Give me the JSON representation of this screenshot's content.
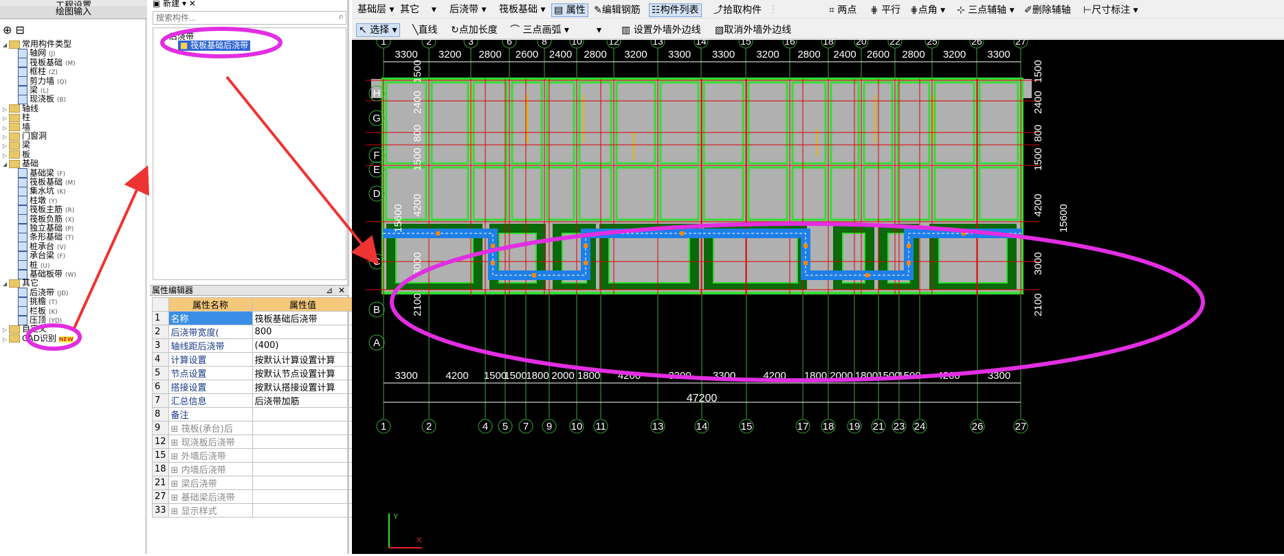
{
  "left_panel": {
    "header1": "工程设置",
    "header2": "绘图输入",
    "tree": [
      {
        "label": "常用构件类型",
        "type": "folder",
        "level": 0,
        "open": true
      },
      {
        "label": "轴网",
        "hint": "(J)",
        "type": "item",
        "level": 1
      },
      {
        "label": "筏板基础",
        "hint": "(M)",
        "type": "item",
        "level": 1
      },
      {
        "label": "框柱",
        "hint": "(Z)",
        "type": "item",
        "level": 1
      },
      {
        "label": "剪力墙",
        "hint": "(Q)",
        "type": "item",
        "level": 1
      },
      {
        "label": "梁",
        "hint": "(L)",
        "type": "item",
        "level": 1
      },
      {
        "label": "现浇板",
        "hint": "(B)",
        "type": "item",
        "level": 1
      },
      {
        "label": "轴线",
        "type": "folder",
        "level": 0
      },
      {
        "label": "柱",
        "type": "folder",
        "level": 0
      },
      {
        "label": "墙",
        "type": "folder",
        "level": 0
      },
      {
        "label": "门窗洞",
        "type": "folder",
        "level": 0
      },
      {
        "label": "梁",
        "type": "folder",
        "level": 0
      },
      {
        "label": "板",
        "type": "folder",
        "level": 0
      },
      {
        "label": "基础",
        "type": "folder",
        "level": 0,
        "open": true
      },
      {
        "label": "基础梁",
        "hint": "(F)",
        "type": "item",
        "level": 1
      },
      {
        "label": "筏板基础",
        "hint": "(M)",
        "type": "item",
        "level": 1
      },
      {
        "label": "集水坑",
        "hint": "(K)",
        "type": "item",
        "level": 1
      },
      {
        "label": "柱墩",
        "hint": "(Y)",
        "type": "item",
        "level": 1
      },
      {
        "label": "筏板主筋",
        "hint": "(R)",
        "type": "item",
        "level": 1
      },
      {
        "label": "筏板负筋",
        "hint": "(X)",
        "type": "item",
        "level": 1
      },
      {
        "label": "独立基础",
        "hint": "(P)",
        "type": "item",
        "level": 1
      },
      {
        "label": "条形基础",
        "hint": "(T)",
        "type": "item",
        "level": 1
      },
      {
        "label": "桩承台",
        "hint": "(V)",
        "type": "item",
        "level": 1
      },
      {
        "label": "承台梁",
        "hint": "(F)",
        "type": "item",
        "level": 1
      },
      {
        "label": "桩",
        "hint": "(U)",
        "type": "item",
        "level": 1
      },
      {
        "label": "基础板带",
        "hint": "(W)",
        "type": "item",
        "level": 1
      },
      {
        "label": "其它",
        "type": "folder",
        "level": 0,
        "open": true
      },
      {
        "label": "后浇带",
        "hint": "(JD)",
        "type": "item",
        "level": 1
      },
      {
        "label": "挑檐",
        "hint": "(T)",
        "type": "item",
        "level": 1
      },
      {
        "label": "栏板",
        "hint": "(K)",
        "type": "item",
        "level": 1
      },
      {
        "label": "压顶",
        "hint": "(YD)",
        "type": "item",
        "level": 1
      },
      {
        "label": "自定义",
        "type": "folder",
        "level": 0
      },
      {
        "label": "CAD识别",
        "type": "folder",
        "level": 0,
        "badge": "NEW"
      }
    ]
  },
  "component_panel": {
    "new_label": "新建",
    "search_placeholder": "搜索构件...",
    "tree_root": "后浇带",
    "tree_child": "筏板基础后浇带"
  },
  "property_editor": {
    "title": "属性编辑器",
    "col_name": "属性名称",
    "col_value": "属性值",
    "rows": [
      {
        "num": "1",
        "name": "名称",
        "value": "筏板基础后浇带"
      },
      {
        "num": "2",
        "name": "后浇带宽度(",
        "value": "800"
      },
      {
        "num": "3",
        "name": "轴线距后浇带",
        "value": "(400)"
      },
      {
        "num": "4",
        "name": "计算设置",
        "value": "按默认计算设置计算"
      },
      {
        "num": "5",
        "name": "节点设置",
        "value": "按默认节点设置计算"
      },
      {
        "num": "6",
        "name": "搭接设置",
        "value": "按默认搭接设置计算"
      },
      {
        "num": "7",
        "name": "汇总信息",
        "value": "后浇带加筋"
      },
      {
        "num": "8",
        "name": "备注",
        "value": ""
      },
      {
        "num": "9",
        "name": "筏板(承台)后",
        "value": ""
      },
      {
        "num": "12",
        "name": "现浇板后浇带",
        "value": ""
      },
      {
        "num": "15",
        "name": "外墙后浇带",
        "value": ""
      },
      {
        "num": "18",
        "name": "内墙后浇带",
        "value": ""
      },
      {
        "num": "21",
        "name": "梁后浇带",
        "value": ""
      },
      {
        "num": "27",
        "name": "基础梁后浇带",
        "value": ""
      },
      {
        "num": "33",
        "name": "显示样式",
        "value": ""
      }
    ]
  },
  "toolbar1": {
    "layer": "基础层",
    "category": "其它",
    "type": "后浇带",
    "component": "筏板基础",
    "attr": "属性",
    "edit_rebar": "编辑钢筋",
    "component_list": "构件列表",
    "pick": "拾取构件",
    "two_point": "两点",
    "parallel": "平行",
    "point_angle": "点角",
    "three_point_aux": "三点辅轴",
    "delete_aux": "删除辅轴",
    "dim": "尺寸标注"
  },
  "toolbar2": {
    "select": "选择",
    "line": "直线",
    "point_length": "点加长度",
    "arc": "三点画弧",
    "set_outer": "设置外墙外边线",
    "cancel_outer": "取消外墙外边线"
  },
  "drawing": {
    "top_total": "47200",
    "bottom_total": "47200",
    "left_total": "15600",
    "right_total": "15600",
    "top_axes": [
      "1",
      "2",
      "3",
      "6",
      "8",
      "10",
      "12",
      "13",
      "14",
      "15",
      "16",
      "18",
      "20",
      "22",
      "25",
      "26",
      "27"
    ],
    "top_dims": [
      "3300",
      "3200",
      "2800",
      "2600",
      "2400",
      "2800",
      "3200",
      "3300",
      "3300",
      "3200",
      "2800",
      "2400",
      "2600",
      "2800",
      "3200",
      "3300"
    ],
    "bottom_axes": [
      "1",
      "2",
      "4",
      "5",
      "7",
      "9",
      "10",
      "11",
      "13",
      "14",
      "15",
      "17",
      "18",
      "19",
      "21",
      "23",
      "24",
      "26",
      "27"
    ],
    "bottom_dims": [
      "3300",
      "4200",
      "1500",
      "1500",
      "1800",
      "2000",
      "1800",
      "4200",
      "3300",
      "3300",
      "4200",
      "1800",
      "2000",
      "1800",
      "1500",
      "1500",
      "4200",
      "3300"
    ],
    "row_axes": [
      "H",
      "G",
      "F",
      "E",
      "D",
      "C",
      "B",
      "A"
    ],
    "row_dims": [
      "1500",
      "2400",
      "800",
      "1500",
      "4200",
      "3000",
      "2100"
    ],
    "coord_y": "Y",
    "coord_x": "X"
  },
  "colors": {
    "canvas_bg": "#000000",
    "slab": "#b0b0b0",
    "green": "#33dd33",
    "dark_green": "#0a6a0a",
    "pour_strip": "#1e7fe8",
    "highlight": "#e22ee2",
    "arrow": "#ee3333",
    "grid": "#dd0000",
    "axis_line": "#3aa83a"
  }
}
